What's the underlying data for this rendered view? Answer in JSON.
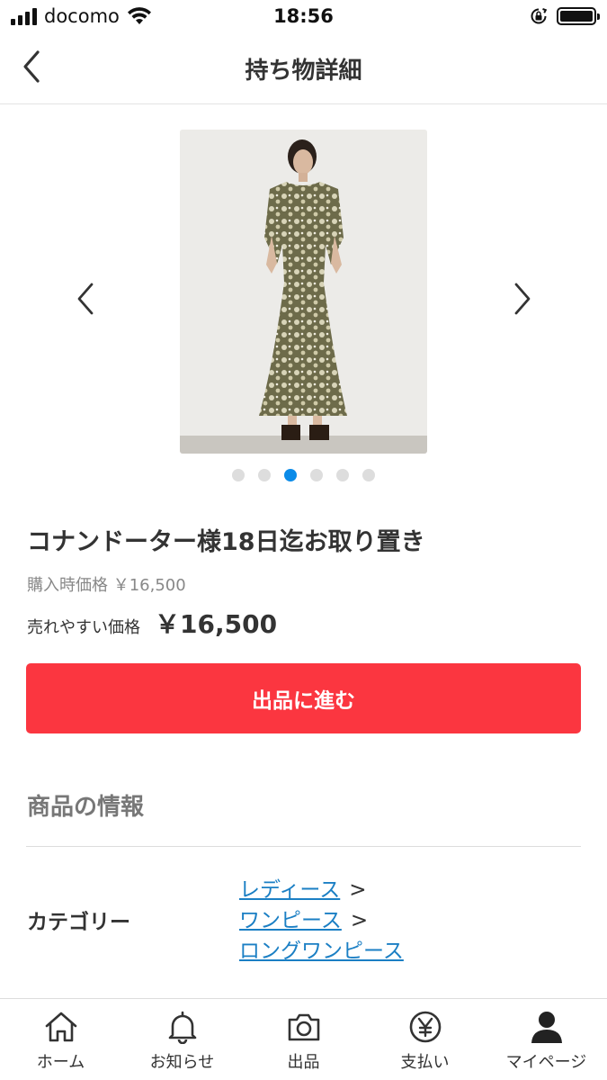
{
  "status_bar": {
    "carrier": "docomo",
    "time": "18:56"
  },
  "nav": {
    "title": "持ち物詳細"
  },
  "carousel": {
    "image_count": 6,
    "active_index": 2
  },
  "item": {
    "title": "コナンドーター様18日迄お取り置き",
    "purchase_price": "購入時価格 ￥16,500",
    "sell_price_label": "売れやすい価格",
    "sell_price": "￥16,500"
  },
  "cta": {
    "label": "出品に進む"
  },
  "product_info": {
    "section_title": "商品の情報",
    "category_label": "カテゴリー",
    "categories": [
      "レディース",
      "ワンピース",
      "ロングワンピース"
    ],
    "separator": ">"
  },
  "tabbar": {
    "items": [
      {
        "label": "ホーム",
        "icon": "home-icon"
      },
      {
        "label": "お知らせ",
        "icon": "bell-icon"
      },
      {
        "label": "出品",
        "icon": "camera-icon"
      },
      {
        "label": "支払い",
        "icon": "yen-icon"
      },
      {
        "label": "マイページ",
        "icon": "person-icon"
      }
    ]
  },
  "colors": {
    "accent_red": "#fb3640",
    "link_blue": "#1b7fc4",
    "active_dot": "#0b8be8"
  }
}
